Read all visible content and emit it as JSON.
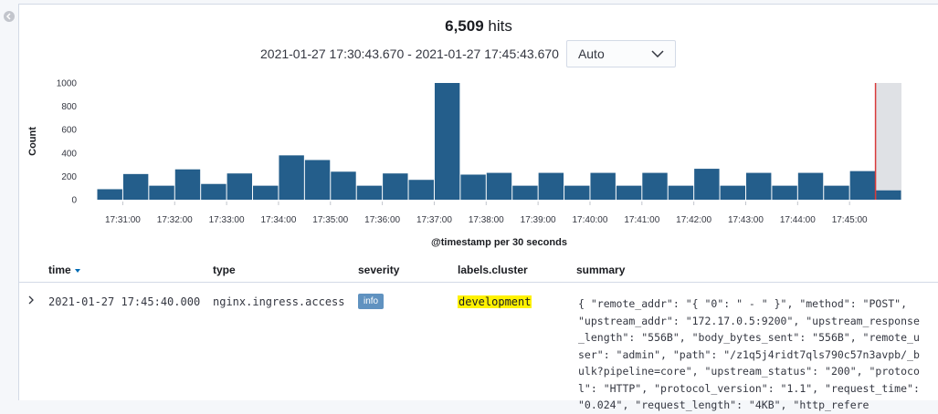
{
  "header": {
    "hits_count": "6,509",
    "hits_label": "hits",
    "time_range": "2021-01-27 17:30:43.670 - 2021-01-27 17:45:43.670",
    "interval": "Auto"
  },
  "chart_data": {
    "type": "bar",
    "ylabel": "Count",
    "xlabel": "@timestamp per 30 seconds",
    "ylim": [
      0,
      1000
    ],
    "yticks": [
      0,
      200,
      400,
      600,
      800,
      1000
    ],
    "xticks": [
      "17:31:00",
      "17:32:00",
      "17:33:00",
      "17:34:00",
      "17:35:00",
      "17:36:00",
      "17:37:00",
      "17:38:00",
      "17:39:00",
      "17:40:00",
      "17:41:00",
      "17:42:00",
      "17:43:00",
      "17:44:00",
      "17:45:00"
    ],
    "values": [
      90,
      220,
      120,
      260,
      135,
      225,
      120,
      380,
      340,
      240,
      120,
      225,
      170,
      1000,
      215,
      230,
      120,
      230,
      120,
      230,
      120,
      230,
      120,
      265,
      120,
      230,
      120,
      230,
      120,
      245,
      80
    ],
    "bar_color": "#245e8b",
    "partial_bucket_shading": "#dfe1e5",
    "current_time_marker_color": "#d93a3a",
    "grid": false
  },
  "table": {
    "columns": [
      {
        "label": "time",
        "sorted": "desc"
      },
      {
        "label": "type"
      },
      {
        "label": "severity"
      },
      {
        "label": "labels.cluster"
      },
      {
        "label": "summary"
      }
    ],
    "rows": [
      {
        "time": "2021-01-27 17:45:40.000",
        "type": "nginx.ingress.access",
        "severity": "info",
        "cluster": "development",
        "summary": "{ \"remote_addr\": \"{ \"0\": \" - \" }\", \"method\": \"POST\", \"upstream_addr\": \"172.17.0.5:9200\", \"upstream_response_length\": \"556B\", \"body_bytes_sent\": \"556B\", \"remote_user\": \"admin\", \"path\": \"/z1q5j4ridt7qls790c57n3avpb/_bulk?pipeline=core\", \"upstream_status\": \"200\", \"protocol\": \"HTTP\", \"protocol_version\": \"1.1\", \"request_time\": \"0.024\", \"request_length\": \"4KB\", \"http_refere"
      }
    ]
  },
  "colors": {
    "badge_info": "#6092c0",
    "highlight": "#fff200",
    "sort_arrow": "#006bb4"
  }
}
